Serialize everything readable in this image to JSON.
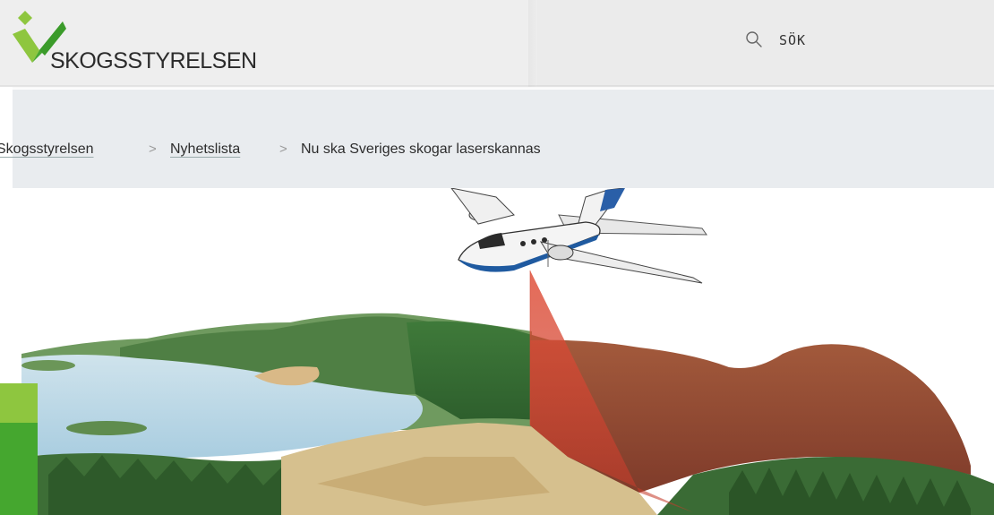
{
  "header": {
    "logo_text": "SKOGSSTYRELSEN",
    "search_label": "SÖK",
    "search_icon": "search-icon"
  },
  "breadcrumb": {
    "items": [
      {
        "label": "Skogsstyrelsen",
        "link": true
      },
      {
        "label": "Nyhetslista",
        "link": true
      },
      {
        "label": "Nu ska Sveriges skogar laserskannas",
        "link": false
      }
    ],
    "separator": ">"
  },
  "colors": {
    "brand_green": "#45a72f",
    "brand_light_green": "#8ec63f",
    "header_bg": "#ededed",
    "breadcrumb_bg": "#e9ecef",
    "laser_red": "#e0503a"
  }
}
